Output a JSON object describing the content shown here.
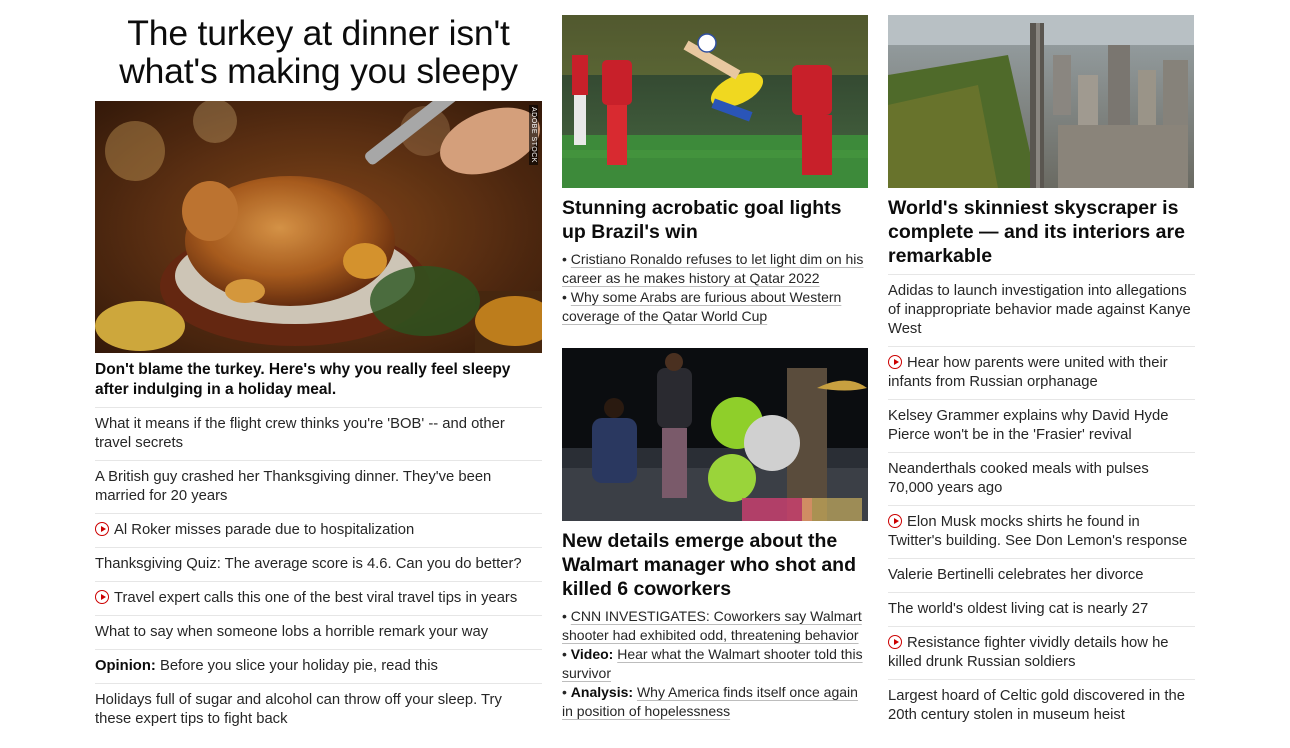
{
  "col1": {
    "hero_title": "The turkey at dinner isn't what's making you sleepy",
    "image_credit": "ADOBE STOCK",
    "hero_caption": "Don't blame the turkey. Here's why you really feel sleepy after indulging in a holiday meal.",
    "items": [
      {
        "text": "What it means if the flight crew thinks you're 'BOB' -- and other travel secrets",
        "video": false,
        "label": ""
      },
      {
        "text": "A British guy crashed her Thanksgiving dinner. They've been married for 20 years",
        "video": false,
        "label": ""
      },
      {
        "text": "Al Roker misses parade due to hospitalization",
        "video": true,
        "label": ""
      },
      {
        "text": "Thanksgiving Quiz: The average score is 4.6. Can you do better?",
        "video": false,
        "label": ""
      },
      {
        "text": "Travel expert calls this one of the best viral travel tips in years",
        "video": true,
        "label": ""
      },
      {
        "text": "What to say when someone lobs a horrible remark your way",
        "video": false,
        "label": ""
      },
      {
        "text": "Before you slice your holiday pie, read this",
        "video": false,
        "label": "Opinion:"
      },
      {
        "text": "Holidays full of sugar and alcohol can throw off your sleep. Try these expert tips to fight back",
        "video": false,
        "label": ""
      }
    ]
  },
  "col2": {
    "story1": {
      "title": "Stunning acrobatic goal lights up Brazil's win",
      "links": [
        {
          "label": "",
          "text": "Cristiano Ronaldo refuses to let light dim on his career as he makes history at Qatar 2022"
        },
        {
          "label": "",
          "text": "Why some Arabs are furious about Western coverage of the Qatar World Cup"
        }
      ]
    },
    "story2": {
      "title": "New details emerge about the Walmart manager who shot and killed 6 coworkers",
      "links": [
        {
          "label": "",
          "text": "CNN INVESTIGATES: Coworkers say Walmart shooter had exhibited odd, threatening behavior"
        },
        {
          "label": "Video:",
          "text": "Hear what the Walmart shooter told this survivor"
        },
        {
          "label": "Analysis:",
          "text": "Why America finds itself once again in position of hopelessness"
        }
      ]
    }
  },
  "col3": {
    "title": "World's skinniest skyscraper is complete — and its interiors are remarkable",
    "items": [
      {
        "text": "Adidas to launch investigation into allegations of inappropriate behavior made against Kanye West",
        "video": false
      },
      {
        "text": "Hear how parents were united with their infants from Russian orphanage",
        "video": true
      },
      {
        "text": "Kelsey Grammer explains why David Hyde Pierce won't be in the 'Frasier' revival",
        "video": false
      },
      {
        "text": "Neanderthals cooked meals with pulses 70,000 years ago",
        "video": false
      },
      {
        "text": "Elon Musk mocks shirts he found in Twitter's building. See Don Lemon's response",
        "video": true
      },
      {
        "text": "Valerie Bertinelli celebrates her divorce",
        "video": false
      },
      {
        "text": "The world's oldest living cat is nearly 27",
        "video": false
      },
      {
        "text": "Resistance fighter vividly details how he killed drunk Russian soldiers",
        "video": true
      },
      {
        "text": "Largest hoard of Celtic gold discovered in the 20th century stolen in museum heist",
        "video": false
      }
    ]
  },
  "colors": {
    "accent": "#cc0000",
    "text": "#0c0c0c",
    "divider": "#e6e6e6"
  }
}
